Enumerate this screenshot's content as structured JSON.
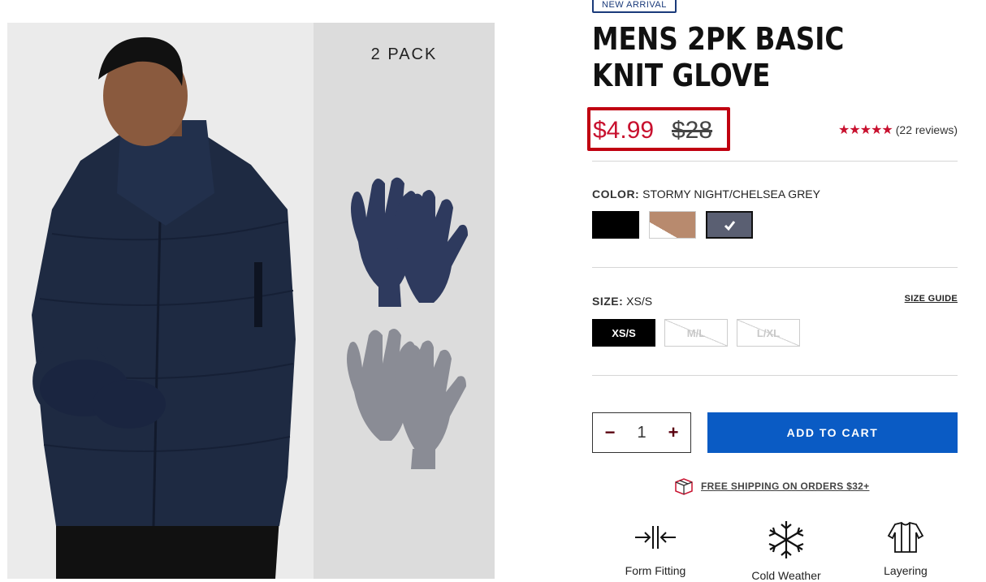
{
  "gallery": {
    "pack_label": "2 PACK"
  },
  "product": {
    "badge": "NEW ARRIVAL",
    "title": "MENS 2PK BASIC KNIT GLOVE",
    "price_now": "$4.99",
    "price_was": "$28",
    "stars": "★★★★★",
    "reviews": "(22 reviews)"
  },
  "color": {
    "label": "COLOR:",
    "value": "STORMY NIGHT/CHELSEA GREY",
    "swatches": [
      {
        "name": "black",
        "color": "#000000"
      },
      {
        "name": "tan-white",
        "color": "#b88a6e"
      },
      {
        "name": "stormy-night-chelsea-grey",
        "color": "#5a5f72",
        "selected": true
      }
    ]
  },
  "size": {
    "label": "SIZE:",
    "value": "XS/S",
    "guide": "SIZE GUIDE",
    "options": [
      "XS/S",
      "M/L",
      "L/XL"
    ]
  },
  "quantity": {
    "minus": "−",
    "value": "1",
    "plus": "+"
  },
  "cart": {
    "label": "ADD TO CART"
  },
  "shipping": {
    "text": "FREE SHIPPING ON ORDERS $32+"
  },
  "features": [
    {
      "icon": "form-fitting-icon",
      "label": "Form Fitting"
    },
    {
      "icon": "snowflake-icon",
      "label": "Cold Weather"
    },
    {
      "icon": "layering-icon",
      "label": "Layering"
    }
  ],
  "colors": {
    "price_red": "#c8102e",
    "highlight_red": "#c00010",
    "cart_blue": "#0a5bc4",
    "badge_navy": "#1a3a7a"
  }
}
